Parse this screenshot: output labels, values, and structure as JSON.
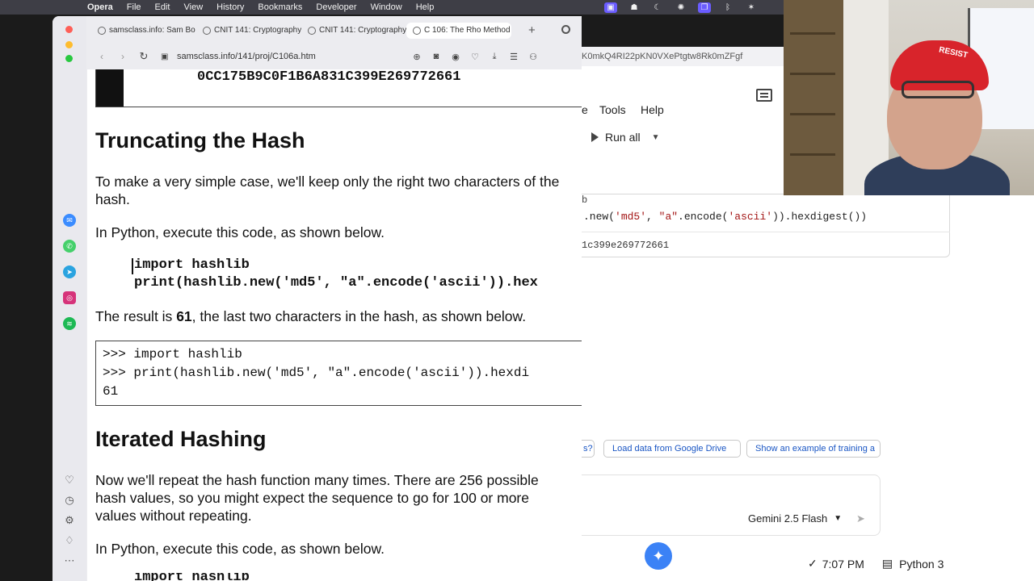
{
  "menubar": {
    "items": [
      "Opera",
      "File",
      "Edit",
      "View",
      "History",
      "Bookmarks",
      "Developer",
      "Window",
      "Help"
    ]
  },
  "browser": {
    "tabs": [
      {
        "label": "samsclass.info: Sam Bo"
      },
      {
        "label": "CNIT 141: Cryptography"
      },
      {
        "label": "CNIT 141: Cryptography"
      },
      {
        "label": "C 106: The Rho Method"
      }
    ],
    "url": "samsclass.info/141/proj/C106a.htm"
  },
  "page": {
    "hash_value": "0CC175B9C0F1B6A831C399E269772661",
    "section1_title": "Truncating the Hash",
    "para1": "To make a very simple case, we'll keep only the right two characters of the hash.",
    "para2": "In Python, execute this code, as shown below.",
    "code_line1": "import hashlib",
    "code_line2": "print(hashlib.new('md5', \"a\".encode('ascii')).hex",
    "result_prefix": "The result is ",
    "result_value": "61",
    "result_suffix": ", the last two characters in the hash, as shown below.",
    "term_line1": ">>> import hashlib",
    "term_line2": ">>> print(hashlib.new('md5', \"a\".encode('ascii')).hexdi",
    "term_line3": "61",
    "section2_title": "Iterated Hashing",
    "para3": "Now we'll repeat the hash function many times. There are 256 possible hash values, so you might expect the sequence to go for 100 or more values without repeating.",
    "para4": "In Python, execute this code, as shown below."
  },
  "colab": {
    "url_partial": "K0mkQ4RI22pKN0VXePtgtw8Rk0mZFgf",
    "menu_partial": "e",
    "menu_tools": "Tools",
    "menu_help": "Help",
    "run_all": "Run all",
    "cell_partial": "b",
    "cell_code_prefix": ".new(",
    "cell_code_str1": "'md5'",
    "cell_code_mid": ", ",
    "cell_code_str2": "\"a\"",
    "cell_code_mid2": ".encode(",
    "cell_code_str3": "'ascii'",
    "cell_code_suffix": ")).hexdigest())",
    "cell_output": "1c399e269772661",
    "chip1": "s?",
    "chip2": "Load data from Google Drive",
    "chip3": "Show an example of training a",
    "model": "Gemini 2.5 Flash",
    "status_time": "7:07 PM",
    "status_runtime": "Python 3"
  },
  "webcam": {
    "cap_text": "RESIST"
  },
  "colors": {
    "accent": "#6a5cff",
    "link": "#1a56c4",
    "traffic_red": "#fe5f57",
    "traffic_yellow": "#febc2e",
    "traffic_green": "#28c840"
  }
}
